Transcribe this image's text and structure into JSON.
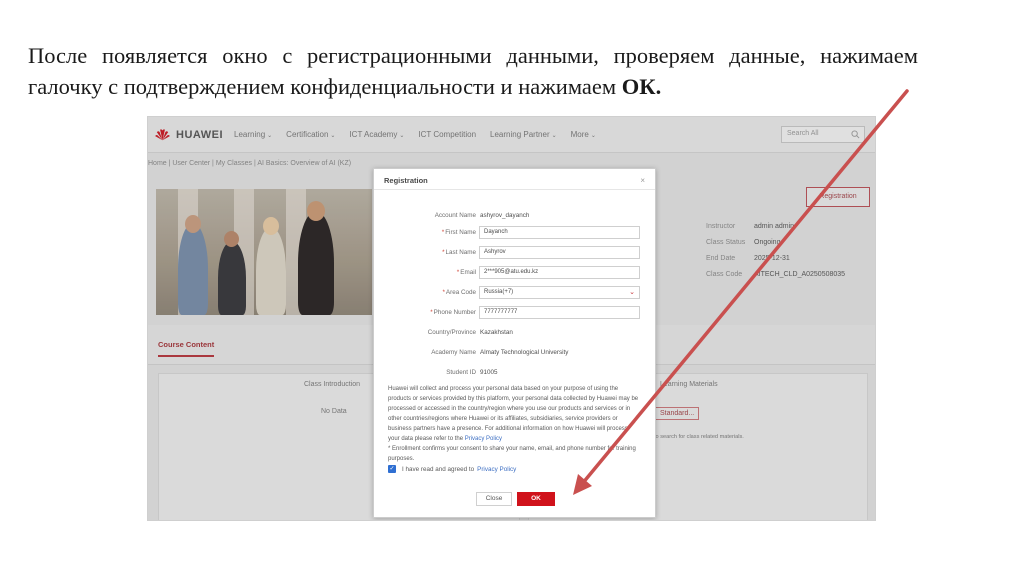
{
  "caption": {
    "text": "После появляется окно с регистрационными данными, проверяем данные, нажимаем галочку с подтверждением конфиденциальности и нажимаем ",
    "bold": "ОК."
  },
  "site": {
    "brand": "HUAWEI",
    "nav": [
      "Learning",
      "Certification",
      "ICT Academy",
      "ICT Competition",
      "Learning Partner",
      "More"
    ],
    "search_placeholder": "Search All",
    "breadcrumb": "Home | User Center | My Classes | AI Basics: Overview of AI (KZ)",
    "registration_button": "Registration",
    "course_info": [
      {
        "k": "Instructor",
        "v": "admin admin"
      },
      {
        "k": "Class Status",
        "v": "Ongoing"
      },
      {
        "k": "End Date",
        "v": "2025-12-31"
      },
      {
        "k": "Class Code",
        "v": "AITECH_CLD_A0250508035"
      }
    ],
    "tab_course_content": "Course Content",
    "panel_class_intro": "Class Introduction",
    "panel_no_data": "No Data",
    "panel_learning_materials": "Learning Materials",
    "panel_standard": "Standard...",
    "panel_hint": "to search for class related materials."
  },
  "dialog": {
    "title": "Registration",
    "close_glyph": "×",
    "fields": [
      {
        "label": "Account Name",
        "value": "ashyrov_dayanch",
        "required": false,
        "input": false
      },
      {
        "label": "First Name",
        "value": "Dayanch",
        "required": true,
        "input": true
      },
      {
        "label": "Last Name",
        "value": "Ashyrov",
        "required": true,
        "input": true
      },
      {
        "label": "Email",
        "value": "2***905@atu.edu.kz",
        "required": true,
        "input": true
      },
      {
        "label": "Area Code",
        "value": "Russia(+7)",
        "required": true,
        "input": true,
        "select": true
      },
      {
        "label": "Phone Number",
        "value": "7777777777",
        "required": true,
        "input": true
      },
      {
        "label": "Country/Province",
        "value": "Kazakhstan",
        "required": false,
        "input": false
      },
      {
        "label": "Academy Name",
        "value": "Almaty Technological University",
        "required": false,
        "input": false
      },
      {
        "label": "Student ID",
        "value": "91005",
        "required": false,
        "input": false
      }
    ],
    "consent_text": "Huawei will collect and process your personal data based on your purpose of using the products or services provided by this platform, your personal data collected by Huawei may be processed or accessed in the country/region where you use our products and services or in other countries/regions where Huawei or its affiliates, subsidiaries, service providers or business partners have a presence. For additional information on how Huawei will process your data please refer to the ",
    "consent_link": "Privacy Policy",
    "enrollment_text": "* Enrollment confirms your consent to share your name, email, and phone number for training purposes.",
    "agree_text": "I have read and agreed to",
    "agree_link": "Privacy Policy",
    "checkbox_glyph": "✓",
    "btn_close": "Close",
    "btn_ok": "OK"
  },
  "colors": {
    "accent_red": "#d0121b",
    "arrow": "#c9504f",
    "link": "#3d6fc3"
  }
}
